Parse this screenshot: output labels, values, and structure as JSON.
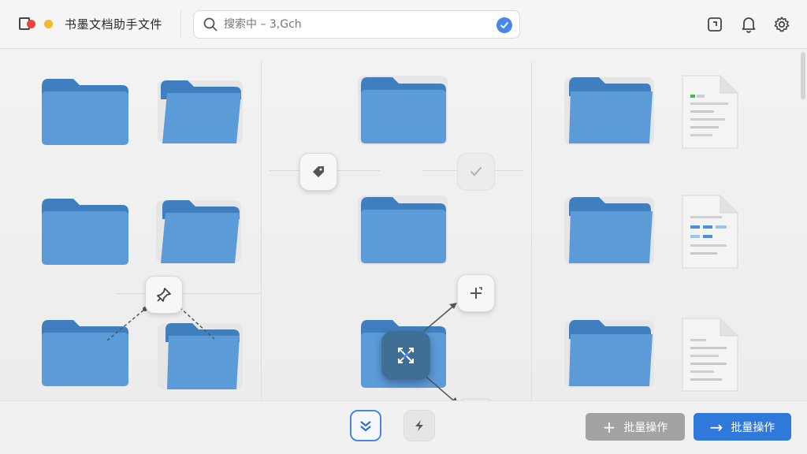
{
  "header": {
    "title": "书墨文档助手文件",
    "search_placeholder": "搜索中 – 3,Gch",
    "icons": [
      "window-icon",
      "bell-icon",
      "settings-icon"
    ]
  },
  "colors": {
    "accent": "#4a86e8",
    "folder": "#5b9bd8",
    "folder_tab": "#3f7fbf",
    "close_dot": "#e8463a",
    "minimize_dot": "#f5b82a",
    "secondary_button": "#a3a3a3",
    "primary_button": "#2f79db"
  },
  "footer": {
    "secondary_action": {
      "icon": "plus",
      "label": "批量操作"
    },
    "primary_action": {
      "icon": "→",
      "label": "批量操作"
    }
  }
}
